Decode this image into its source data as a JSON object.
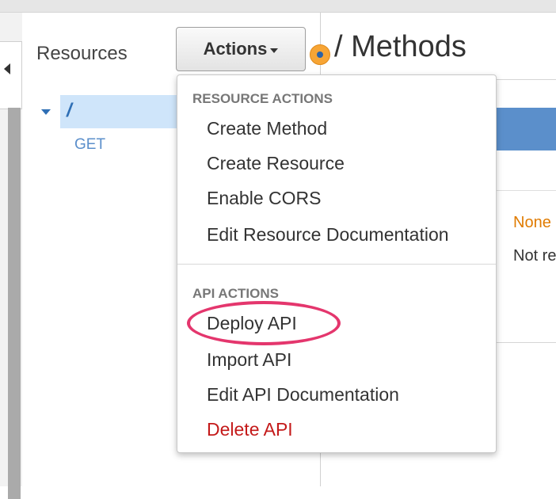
{
  "sidebar": {
    "header": "Resources",
    "tree": {
      "root_label": "/",
      "methods": [
        "GET"
      ]
    }
  },
  "toolbar": {
    "actions_label": "Actions"
  },
  "main": {
    "title": "/ Methods",
    "authorization_value": "None",
    "api_key_value": "Not re"
  },
  "actions_menu": {
    "resource_actions_heading": "RESOURCE ACTIONS",
    "resource_actions": [
      "Create Method",
      "Create Resource",
      "Enable CORS",
      "Edit Resource Documentation"
    ],
    "api_actions_heading": "API ACTIONS",
    "api_actions": [
      "Deploy API",
      "Import API",
      "Edit API Documentation",
      "Delete API"
    ]
  },
  "colors": {
    "accent_blue": "#5b8fcb",
    "selection": "#cfe5fa",
    "danger": "#c41a1a",
    "warning": "#e07b00",
    "highlight": "#e4366d"
  }
}
